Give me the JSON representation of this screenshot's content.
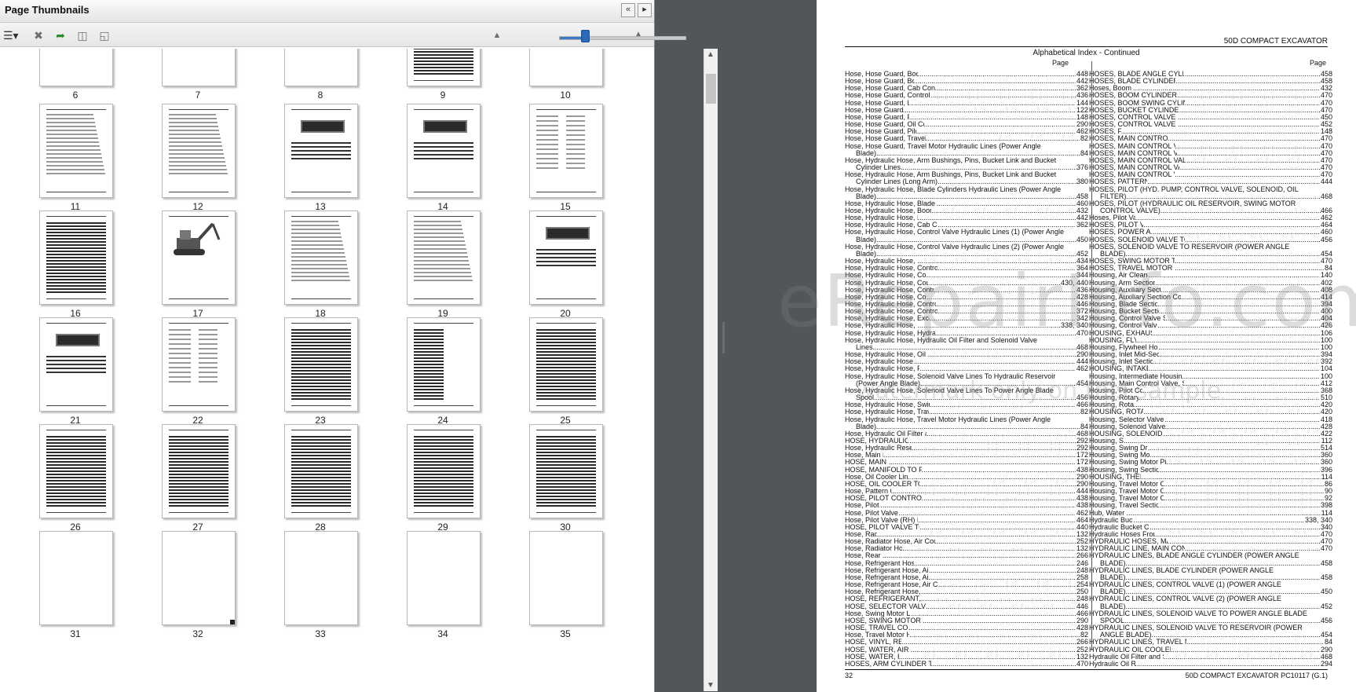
{
  "panel": {
    "title": "Page Thumbnails",
    "thumbnail_pages": [
      "6",
      "7",
      "8",
      "9",
      "10",
      "11",
      "12",
      "13",
      "14",
      "15",
      "16",
      "17",
      "18",
      "19",
      "20",
      "21",
      "22",
      "23",
      "24",
      "25",
      "26",
      "27",
      "28",
      "29",
      "30",
      "31",
      "32",
      "33",
      "34",
      "35"
    ],
    "zoom_slider_value": 0.2
  },
  "document": {
    "header": "50D COMPACT EXCAVATOR",
    "subtitle": "Alphabetical Index - Continued",
    "page_label_left": "Page",
    "page_label_right": "Page",
    "footer_left": "32",
    "footer_right": "50D COMPACT EXCAVATOR    PC10117    (G.1)",
    "watermark": "eRepairInfo.com",
    "watermark_sub": "watermark only on this sample",
    "left_column": [
      {
        "t": "Hose, Hose Guard, Boom Hose Protectors",
        "p": "448"
      },
      {
        "t": "Hose, Hose Guard, Boom Lines To Arm",
        "p": "442"
      },
      {
        "t": "Hose, Hose Guard, Cab Control Levers (Auxiliary Function)",
        "p": "362"
      },
      {
        "t": "Hose, Hose Guard, Control Valve Lines (Pump & Filter)",
        "p": "436"
      },
      {
        "t": "Hose, Hose Guard, Engine Mounts",
        "p": "144"
      },
      {
        "t": "Hose, Hose Guard, Fuel Filters",
        "p": "122"
      },
      {
        "t": "Hose, Hose Guard, Fuel Tank Lines",
        "p": "148"
      },
      {
        "t": "Hose, Hose Guard, Oil Cooler Lines and Fittings",
        "p": "290"
      },
      {
        "t": "Hose, Hose Guard, Pilot Valve (LH) Lines",
        "p": "462"
      },
      {
        "t": "Hose, Hose Guard, Travel Motor Hydraulic Lines",
        "p": "82"
      },
      {
        "t": "Hose, Hose Guard, Travel Motor Hydraulic Lines (Power Angle",
        "p": ""
      },
      {
        "t": "Blade)",
        "p": "84",
        "w": true
      },
      {
        "t": "Hose, Hydraulic Hose, Arm Bushings, Pins, Bucket Link and Bucket",
        "p": ""
      },
      {
        "t": "Cylinder Lines",
        "p": "376",
        "w": true
      },
      {
        "t": "Hose, Hydraulic Hose, Arm Bushings, Pins, Bucket Link and Bucket",
        "p": ""
      },
      {
        "t": "Cylinder Lines (Long Arm)",
        "p": "380",
        "w": true
      },
      {
        "t": "Hose, Hydraulic Hose, Blade Cylinders Hydraulic Lines (Power Angle",
        "p": ""
      },
      {
        "t": "Blade)",
        "p": "458",
        "w": true
      },
      {
        "t": "Hose, Hydraulic Hose, Blade Pilot Lines (Power Angle Blade)",
        "p": "460"
      },
      {
        "t": "Hose, Hydraulic Hose, Boom Lines and Fittings (Upper)",
        "p": "432"
      },
      {
        "t": "Hose, Hydraulic Hose, Boom Lines To Arm",
        "p": "442"
      },
      {
        "t": "Hose, Hydraulic Hose, Cab Control Levers (Auxiliary Function)",
        "p": "362"
      },
      {
        "t": "Hose, Hydraulic Hose, Control Valve Hydraulic Lines (1) (Power Angle",
        "p": ""
      },
      {
        "t": "Blade)",
        "p": "450",
        "w": true
      },
      {
        "t": "Hose, Hydraulic Hose, Control Valve Hydraulic Lines (2) (Power Angle",
        "p": ""
      },
      {
        "t": "Blade)",
        "p": "452",
        "w": true
      },
      {
        "t": "Hose, Hydraulic Hose, Control Valve Lines",
        "p": "434"
      },
      {
        "t": "Hose, Hydraulic Hose, Control Valve Lines (Attachment Pedal)",
        "p": "364"
      },
      {
        "t": "Hose, Hydraulic Hose, Control Valve Lines (Blade)",
        "p": "344"
      },
      {
        "t": "Hose, Hydraulic Hose, Control Valve Lines (Boom Swing)",
        "p": "430, 440"
      },
      {
        "t": "Hose, Hydraulic Hose, Control Valve Lines (Pump & Filter)",
        "p": "436"
      },
      {
        "t": "Hose, Hydraulic Hose, Control Valve Lines (Travel)",
        "p": "428"
      },
      {
        "t": "Hose, Hydraulic Hose, Control Valve Lines To Selector Valve",
        "p": "446"
      },
      {
        "t": "Hose, Hydraulic Hose, Control Valve Lines To Travel Controller",
        "p": "372"
      },
      {
        "t": "Hose, Hydraulic Hose, Excavator Hammer Adapter Kit",
        "p": "342"
      },
      {
        "t": "Hose, Hydraulic Hose, Hydraulic Bucket Clamp",
        "p": "338, 340"
      },
      {
        "t": "Hose, Hydraulic Hose, Hydraulic Hoses From Control Valve",
        "p": "470"
      },
      {
        "t": "Hose, Hydraulic Hose, Hydraulic Oil Filter and Solenoid Valve",
        "p": ""
      },
      {
        "t": "Lines",
        "p": "468",
        "w": true
      },
      {
        "t": "Hose, Hydraulic Hose, Oil Cooler Lines and Fittings",
        "p": "290"
      },
      {
        "t": "Hose, Hydraulic Hose, Pattern Changer",
        "p": "444"
      },
      {
        "t": "Hose, Hydraulic Hose, Pilot Valve (LH) Lines",
        "p": "462"
      },
      {
        "t": "Hose, Hydraulic Hose, Solenoid Valve Lines To Hydraulic Reservoir",
        "p": ""
      },
      {
        "t": "(Power Angle Blade)",
        "p": "454",
        "w": true
      },
      {
        "t": "Hose, Hydraulic Hose, Solenoid Valve Lines To Power Angle Blade",
        "p": ""
      },
      {
        "t": "Spool",
        "p": "456",
        "w": true
      },
      {
        "t": "Hose, Hydraulic Hose, Swing Motor Lines and Fittings",
        "p": "466"
      },
      {
        "t": "Hose, Hydraulic Hose, Travel Motor Hydraulic Lines",
        "p": "82"
      },
      {
        "t": "Hose, Hydraulic Hose, Travel Motor Hydraulic Lines (Power Angle",
        "p": ""
      },
      {
        "t": "Blade)",
        "p": "84",
        "w": true
      },
      {
        "t": "Hose, Hydraulic Oil Filter and Solenoid Valve Lines",
        "p": "468"
      },
      {
        "t": "HOSE, HYDRAULIC RESERVOIR",
        "p": "292"
      },
      {
        "t": "Hose, Hydraulic Reservoir Installation",
        "p": "292"
      },
      {
        "t": "Hose, Main Frame",
        "p": "172"
      },
      {
        "t": "HOSE, MAIN FRAME",
        "p": "172"
      },
      {
        "t": "HOSE, MANIFOLD TO PILOT CONTROLLER",
        "p": "438"
      },
      {
        "t": "Hose, Oil Cooler Lines and Fittings",
        "p": "290"
      },
      {
        "t": "HOSE, OIL COOLER TO CONTROL VALVE",
        "p": "290"
      },
      {
        "t": "Hose, Pattern Changer",
        "p": "444"
      },
      {
        "t": "HOSE, PILOT CONTROLLER TO MANIFOLD",
        "p": "438"
      },
      {
        "t": "Hose, Pilot Lines",
        "p": "438"
      },
      {
        "t": "Hose, Pilot Valve (LH) Lines",
        "p": "462"
      },
      {
        "t": "Hose, Pilot Valve (RH) Lines and Manifolds",
        "p": "464"
      },
      {
        "t": "HOSE, PILOT VALVE TO CONTROL VALVE",
        "p": "440"
      },
      {
        "t": "Hose, Radiator",
        "p": "132"
      },
      {
        "t": "Hose, Radiator Hose, Air Conditioner Isolators And Support",
        "p": "252"
      },
      {
        "t": "Hose, Radiator Hose, Radiator",
        "p": "132"
      },
      {
        "t": "Hose, Rear Cover",
        "p": "266"
      },
      {
        "t": "Hose, Refrigerant Hose, Air Conditioner",
        "p": "246"
      },
      {
        "t": "Hose, Refrigerant Hose, Air Conditioner Components",
        "p": "248"
      },
      {
        "t": "Hose, Refrigerant Hose, Air Conditioner Compressor",
        "p": "258"
      },
      {
        "t": "Hose, Refrigerant Hose, Air Conditioner Condenser ( - 275163)",
        "p": "254"
      },
      {
        "t": "Hose, Refrigerant Hose, Air Conditioner Lines",
        "p": "250"
      },
      {
        "t": "HOSE, REFRIGERANT, AIR CONDITIONER",
        "p": "248"
      },
      {
        "t": "HOSE, SELECTOR VALVE TO CONTROL VALVE",
        "p": "446"
      },
      {
        "t": "Hose, Swing Motor Lines and Fittings",
        "p": "466"
      },
      {
        "t": "HOSE, SWING MOTOR TO CONTROL VALVE",
        "p": "290"
      },
      {
        "t": "HOSE, TRAVEL CONTROL VALVE",
        "p": "428"
      },
      {
        "t": "Hose, Travel Motor Hydraulic Lines",
        "p": "82"
      },
      {
        "t": "HOSE, VINYL, REAR COVER",
        "p": "266"
      },
      {
        "t": "HOSE, WATER, AIR CONDITIONER",
        "p": "252"
      },
      {
        "t": "HOSE, WATER, RADIATOR",
        "p": "132"
      },
      {
        "t": "HOSES, ARM CYLINDER TO MAIN CONTROL VALVE",
        "p": "470"
      }
    ],
    "right_column": [
      {
        "t": "HOSES, BLADE ANGLE CYLINDER (POWER ANGLE BLADE)",
        "p": "458"
      },
      {
        "t": "HOSES, BLADE CYLINDER (POWER ANGLE BLADE)",
        "p": "458"
      },
      {
        "t": "Hoses, Boom (Upper)",
        "p": "432"
      },
      {
        "t": "HOSES, BOOM CYLINDER TO MAIN CONTROL VALVE",
        "p": "470"
      },
      {
        "t": "HOSES, BOOM SWING CYLINDER TO MAIN CONTROL VALVE",
        "p": "470"
      },
      {
        "t": "HOSES, BUCKET CYLINDER TO MAIN CONTROL VALVE",
        "p": "470"
      },
      {
        "t": "HOSES, CONTROL VALVE (1) (POWER ANGLE BLADE)",
        "p": "450"
      },
      {
        "t": "HOSES, CONTROL VALVE (2) (POWER ANGLE BLADE)",
        "p": "452"
      },
      {
        "t": "HOSES, FUEL",
        "p": "148"
      },
      {
        "t": "HOSES, MAIN CONTROL VALVE HYDRAULIC",
        "p": "470"
      },
      {
        "t": "HOSES, MAIN CONTROL VALVE TO ARM CYLINDER",
        "p": "470"
      },
      {
        "t": "HOSES, MAIN CONTROL VALVE TO BOOM CYLINDER",
        "p": "470"
      },
      {
        "t": "HOSES, MAIN CONTROL VALVE TO BOOM SWING CYLINDER",
        "p": "470"
      },
      {
        "t": "HOSES, MAIN CONTROL VALVE TO BUCKET CYLINDER",
        "p": "470"
      },
      {
        "t": "HOSES, MAIN CONTROL VALVE TO SWING MOTOR",
        "p": "470"
      },
      {
        "t": "HOSES, PATTERN CHANGER",
        "p": "444"
      },
      {
        "t": "HOSES, PILOT (HYD. PUMP, CONTROL VALVE, SOLENOID, OIL",
        "p": ""
      },
      {
        "t": "FILTER)",
        "p": "468",
        "w": true
      },
      {
        "t": "HOSES, PILOT (HYDRAULIC OIL RESERVOIR, SWING MOTOR",
        "p": ""
      },
      {
        "t": "CONTROL VALVE)",
        "p": "466",
        "w": true
      },
      {
        "t": "Hoses, Pilot Valve (LH)",
        "p": "462"
      },
      {
        "t": "HOSES, PILOT VALVE (RH)",
        "p": "464"
      },
      {
        "t": "HOSES, POWER ANGLE BLADE",
        "p": "460"
      },
      {
        "t": "HOSES, SOLENOID VALVE TO POWER ANGLE BLADE SPOOL",
        "p": "456"
      },
      {
        "t": "HOSES, SOLENOID VALVE TO RESERVOIR (POWER ANGLE",
        "p": ""
      },
      {
        "t": "BLADE)",
        "p": "454",
        "w": true
      },
      {
        "t": "HOSES, SWING MOTOR TO MAIN CONTROL VALVE",
        "p": "470"
      },
      {
        "t": "HOSES, TRAVEL MOTOR (POWER ANGLE BLADE)",
        "p": "84"
      },
      {
        "t": "Housing, Air Cleaner (Standard)",
        "p": "140"
      },
      {
        "t": "Housing, Arm Section (Control Valve)",
        "p": "402"
      },
      {
        "t": "Housing, Auxiliary Section (Control Valve)",
        "p": "408"
      },
      {
        "t": "Housing, Auxiliary Section Control Valve (Power Angle Blade)",
        "p": "414"
      },
      {
        "t": "Housing, Blade Section (Control Valve)",
        "p": "394"
      },
      {
        "t": "Housing, Bucket Section (Control Valve)",
        "p": "400"
      },
      {
        "t": "Housing, Control Valve Section (Boom Swing)",
        "p": "404"
      },
      {
        "t": "Housing, Control Valve Section (Boom)",
        "p": "426"
      },
      {
        "t": "HOUSING, EXHAUST MANIFOLD",
        "p": "106"
      },
      {
        "t": "HOUSING, FLYWHEEL",
        "p": "100"
      },
      {
        "t": "Housing, Flywheel Housing and Oil Pan",
        "p": "100"
      },
      {
        "t": "Housing, Inlet Mid-Section Control Valve",
        "p": "394"
      },
      {
        "t": "Housing, Inlet Section (Main Valve)",
        "p": "392"
      },
      {
        "t": "HOUSING, INTAKE MANIFOLD",
        "p": "104"
      },
      {
        "t": "Housing, Intermediate Housing, Flywheel Housing and Oil Pan",
        "p": "100"
      },
      {
        "t": "Housing, Main Control Valve, Spool Section (Power Angle Blade)",
        "p": "412"
      },
      {
        "t": "Housing, Pilot Control Valve",
        "p": "368"
      },
      {
        "t": "Housing, Rotary Manifold",
        "p": "510"
      },
      {
        "t": "Housing, Rotary Valve",
        "p": "420"
      },
      {
        "t": "HOUSING, ROTARY VALVE",
        "p": "420"
      },
      {
        "t": "Housing, Selector Valve (Power Angle Blade)",
        "p": "418"
      },
      {
        "t": "Housing, Solenoid Valve (Power Angle Blade)",
        "p": "428"
      },
      {
        "t": "HOUSING, SOLENOID VALVE (TWO-WAY)",
        "p": "422"
      },
      {
        "t": "Housing, Starter",
        "p": "112"
      },
      {
        "t": "Housing, Swing Drive Gear Box",
        "p": "514"
      },
      {
        "t": "Housing, Swing Motor Pilot Valve",
        "p": "360"
      },
      {
        "t": "Housing, Swing Motor Pilot Valve Components",
        "p": "360"
      },
      {
        "t": "Housing, Swing Section (Control Valve)",
        "p": "396"
      },
      {
        "t": "HOUSING, THERMOSTAT",
        "p": "114"
      },
      {
        "t": "Housing, Travel Motor Components (1 of 4)",
        "p": "86"
      },
      {
        "t": "Housing, Travel Motor Components (3 of 4)",
        "p": "90"
      },
      {
        "t": "Housing, Travel Motor Components (4 of 4)",
        "p": "92"
      },
      {
        "t": "Housing, Travel Section (Control Valve)",
        "p": "398"
      },
      {
        "t": "Hub, Water Pump",
        "p": "114"
      },
      {
        "t": "Hydraulic Bucket Clamp",
        "p": "338, 340"
      },
      {
        "t": "Hydraulic Bucket Clamp Cylinder",
        "p": "340"
      },
      {
        "t": "Hydraulic Hoses From Control Valve",
        "p": "470"
      },
      {
        "t": "HYDRAULIC HOSES, MAIN CONTROL VALVE",
        "p": "470"
      },
      {
        "t": "HYDRAULIC LINE, MAIN CONTROL VALVE TO SWING MOTOR",
        "p": "470"
      },
      {
        "t": "HYDRAULIC LINES, BLADE ANGLE CYLINDER (POWER ANGLE",
        "p": ""
      },
      {
        "t": "BLADE)",
        "p": "458",
        "w": true
      },
      {
        "t": "HYDRAULIC LINES, BLADE CYLINDER (POWER ANGLE",
        "p": ""
      },
      {
        "t": "BLADE)",
        "p": "458",
        "w": true
      },
      {
        "t": "HYDRAULIC LINES, CONTROL VALVE (1) (POWER ANGLE",
        "p": ""
      },
      {
        "t": "BLADE)",
        "p": "450",
        "w": true
      },
      {
        "t": "HYDRAULIC LINES, CONTROL VALVE (2) (POWER ANGLE",
        "p": ""
      },
      {
        "t": "BLADE)",
        "p": "452",
        "w": true
      },
      {
        "t": "HYDRAULIC LINES, SOLENOID VALVE TO POWER ANGLE BLADE",
        "p": ""
      },
      {
        "t": "SPOOL",
        "p": "456",
        "w": true
      },
      {
        "t": "HYDRAULIC LINES, SOLENOID VALVE TO RESERVOIR (POWER",
        "p": ""
      },
      {
        "t": "ANGLE BLADE)",
        "p": "454",
        "w": true
      },
      {
        "t": "HYDRAULIC LINES, TRAVEL MOTOR (POWER ANGLE BLADE)",
        "p": "84"
      },
      {
        "t": "HYDRAULIC OIL COOLER LINES AND FITTINGS",
        "p": "290"
      },
      {
        "t": "Hydraulic Oil Filter and Solenoid Valve Lines",
        "p": "468"
      },
      {
        "t": "Hydraulic Oil Reservoir",
        "p": "294"
      }
    ]
  }
}
